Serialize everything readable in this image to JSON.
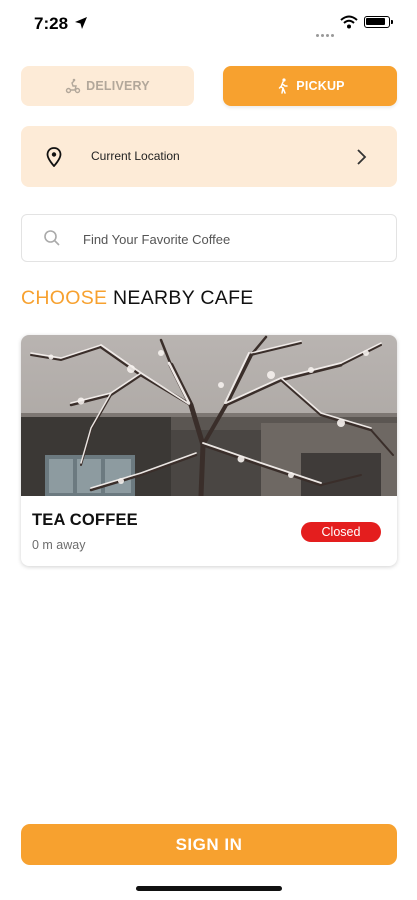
{
  "status_bar": {
    "time": "7:28"
  },
  "mode_toggle": {
    "delivery_label": "DELIVERY",
    "pickup_label": "PICKUP",
    "selected": "pickup"
  },
  "location": {
    "label": "Current Location"
  },
  "search": {
    "placeholder": "Find Your Favorite Coffee",
    "value": ""
  },
  "section": {
    "title_accent": "CHOOSE",
    "title_rest": " NEARBY CAFE"
  },
  "cafes": [
    {
      "name": "TEA COFFEE",
      "distance": "0 m away",
      "status": "Closed"
    }
  ],
  "actions": {
    "sign_in_label": "SIGN IN"
  },
  "colors": {
    "accent": "#f7a12f",
    "accent_soft": "#fdebd7",
    "closed": "#e41e1e"
  },
  "icons": [
    "location-arrow-icon",
    "wifi-icon",
    "battery-icon",
    "scooter-icon",
    "walking-icon",
    "map-pin-icon",
    "chevron-right-icon",
    "search-icon"
  ]
}
